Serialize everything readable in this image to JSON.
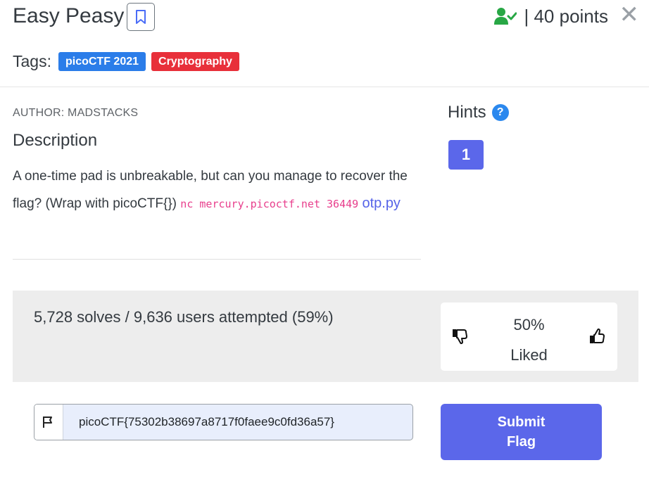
{
  "challenge": {
    "title": "Easy Peasy",
    "points_text": "| 40 points",
    "close_symbol": "✕"
  },
  "tags": {
    "label": "Tags:",
    "items": [
      {
        "label": "picoCTF 2021",
        "color": "#2b7de9"
      },
      {
        "label": "Cryptography",
        "color": "#e8303a"
      }
    ]
  },
  "author": "AUTHOR: MADSTACKS",
  "description": {
    "heading": "Description",
    "text": "A one-time pad is unbreakable, but can you manage to recover the flag? (Wrap with picoCTF{}) ",
    "code": "nc mercury.picoctf.net 36449",
    "link": "otp.py"
  },
  "hints": {
    "heading": "Hints",
    "help_symbol": "?",
    "buttons": [
      "1"
    ]
  },
  "stats": {
    "solves_text": "5,728 solves / 9,636 users attempted (59%)",
    "liked_percent": "50%",
    "liked_label": "Liked"
  },
  "flag_input": {
    "value": "picoCTF{75302b38697a8717f0faee9c0fd36a57}"
  },
  "submit": {
    "line1": "Submit",
    "line2": "Flag"
  },
  "colors": {
    "accent": "#5b67ea",
    "solved_green": "#28a745",
    "code_pink": "#e83e8c"
  }
}
